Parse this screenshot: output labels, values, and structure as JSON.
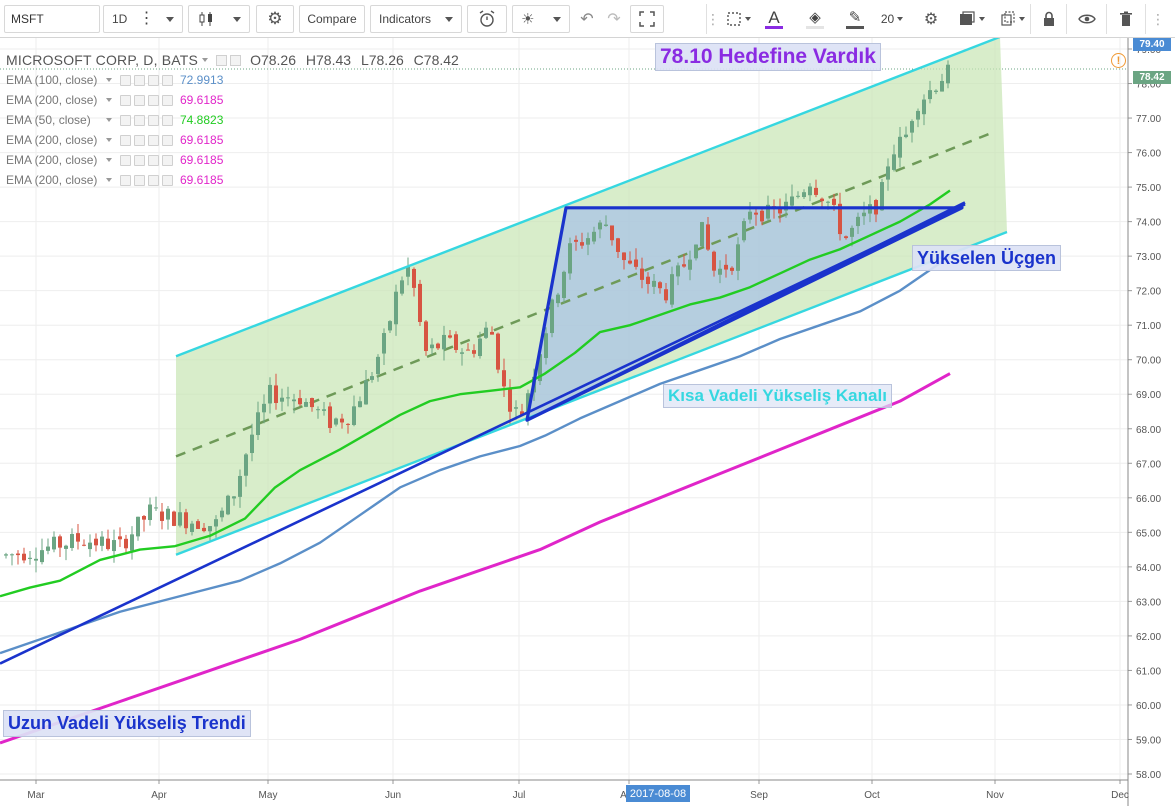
{
  "toolbar": {
    "symbol": "MSFT",
    "interval": "1D",
    "compare_label": "Compare",
    "indicators_label": "Indicators",
    "font_size": "20"
  },
  "legend": {
    "symbol_name": "MICROSOFT CORP, D, BATS",
    "open": "O78.26",
    "high": "H78.43",
    "low": "L78.26",
    "close": "C78.42",
    "indicators": [
      {
        "name": "EMA (100, close)",
        "value": "72.9913",
        "color": "#5b8fc8"
      },
      {
        "name": "EMA (200, close)",
        "value": "69.6185",
        "color": "#e025c9"
      },
      {
        "name": "EMA (50, close)",
        "value": "74.8823",
        "color": "#22cc22"
      },
      {
        "name": "EMA (200, close)",
        "value": "69.6185",
        "color": "#e025c9"
      },
      {
        "name": "EMA (200, close)",
        "value": "69.6185",
        "color": "#e025c9"
      },
      {
        "name": "EMA (200, close)",
        "value": "69.6185",
        "color": "#e025c9"
      }
    ]
  },
  "annotations": {
    "target": "78.10 Hedefine Vardık",
    "triangle": "Yükselen Üçgen",
    "short_channel": "Kısa Vadeli Yükseliş Kanalı",
    "long_trend": "Uzun Vadeli Yükseliş Trendi"
  },
  "price_tags": {
    "top": "79.40",
    "last": "78.42"
  },
  "crosshair_date": "2017-08-08",
  "colors": {
    "up_candle": "#6ba583",
    "down_candle": "#d75442",
    "ema50": "#22cc22",
    "ema100": "#5b8fc8",
    "ema200": "#e025c9",
    "trend_line": "#1a33cc",
    "channel_line": "#36d7e0",
    "channel_fill": "#c8e6b4",
    "triangle_fill": "#a9c3e6"
  },
  "chart_data": {
    "type": "candlestick",
    "x_labels": [
      "Mar",
      "Apr",
      "May",
      "Jun",
      "Jul",
      "Aug",
      "Sep",
      "Oct",
      "Nov",
      "Dec"
    ],
    "y_ticks": [
      "58.00",
      "59.00",
      "60.00",
      "61.00",
      "62.00",
      "63.00",
      "64.00",
      "65.00",
      "66.00",
      "67.00",
      "68.00",
      "69.00",
      "70.00",
      "71.00",
      "72.00",
      "73.00",
      "74.00",
      "75.00",
      "76.00",
      "77.00",
      "78.00",
      "79.00"
    ],
    "ylim": [
      57.7,
      79.6
    ],
    "series": [
      {
        "name": "EMA (50, close)",
        "values": [
          [
            0,
            63.15
          ],
          [
            30,
            63.4
          ],
          [
            60,
            63.6
          ],
          [
            100,
            64.2
          ],
          [
            140,
            64.5
          ],
          [
            175,
            64.6
          ],
          [
            210,
            64.9
          ],
          [
            245,
            65.4
          ],
          [
            275,
            66.3
          ],
          [
            300,
            66.8
          ],
          [
            340,
            67.4
          ],
          [
            370,
            67.9
          ],
          [
            400,
            68.4
          ],
          [
            430,
            68.8
          ],
          [
            460,
            69.0
          ],
          [
            490,
            69.1
          ],
          [
            520,
            69.2
          ],
          [
            545,
            69.6
          ],
          [
            575,
            70.2
          ],
          [
            600,
            70.8
          ],
          [
            630,
            71.0
          ],
          [
            660,
            71.3
          ],
          [
            690,
            71.6
          ],
          [
            720,
            71.8
          ],
          [
            750,
            72.1
          ],
          [
            780,
            72.5
          ],
          [
            810,
            72.9
          ],
          [
            840,
            73.2
          ],
          [
            870,
            73.6
          ],
          [
            900,
            74.0
          ],
          [
            930,
            74.5
          ],
          [
            950,
            74.9
          ]
        ]
      },
      {
        "name": "EMA (100, close)",
        "values": [
          [
            0,
            61.5
          ],
          [
            40,
            61.9
          ],
          [
            80,
            62.3
          ],
          [
            120,
            62.7
          ],
          [
            160,
            63.0
          ],
          [
            200,
            63.3
          ],
          [
            240,
            63.6
          ],
          [
            280,
            64.1
          ],
          [
            320,
            64.7
          ],
          [
            360,
            65.5
          ],
          [
            400,
            66.3
          ],
          [
            440,
            66.8
          ],
          [
            480,
            67.2
          ],
          [
            520,
            67.5
          ],
          [
            545,
            67.8
          ],
          [
            580,
            68.3
          ],
          [
            620,
            68.8
          ],
          [
            660,
            69.3
          ],
          [
            700,
            69.7
          ],
          [
            740,
            70.1
          ],
          [
            780,
            70.6
          ],
          [
            820,
            71.0
          ],
          [
            860,
            71.4
          ],
          [
            900,
            72.0
          ],
          [
            930,
            72.6
          ],
          [
            950,
            73.0
          ]
        ]
      },
      {
        "name": "EMA (200, close)",
        "values": [
          [
            0,
            58.9
          ],
          [
            60,
            59.5
          ],
          [
            120,
            60.1
          ],
          [
            180,
            60.7
          ],
          [
            240,
            61.3
          ],
          [
            300,
            61.9
          ],
          [
            360,
            62.6
          ],
          [
            420,
            63.3
          ],
          [
            480,
            63.9
          ],
          [
            540,
            64.5
          ],
          [
            600,
            65.3
          ],
          [
            660,
            66.0
          ],
          [
            720,
            66.7
          ],
          [
            780,
            67.4
          ],
          [
            840,
            68.1
          ],
          [
            900,
            68.8
          ],
          [
            950,
            69.6
          ]
        ]
      }
    ]
  }
}
